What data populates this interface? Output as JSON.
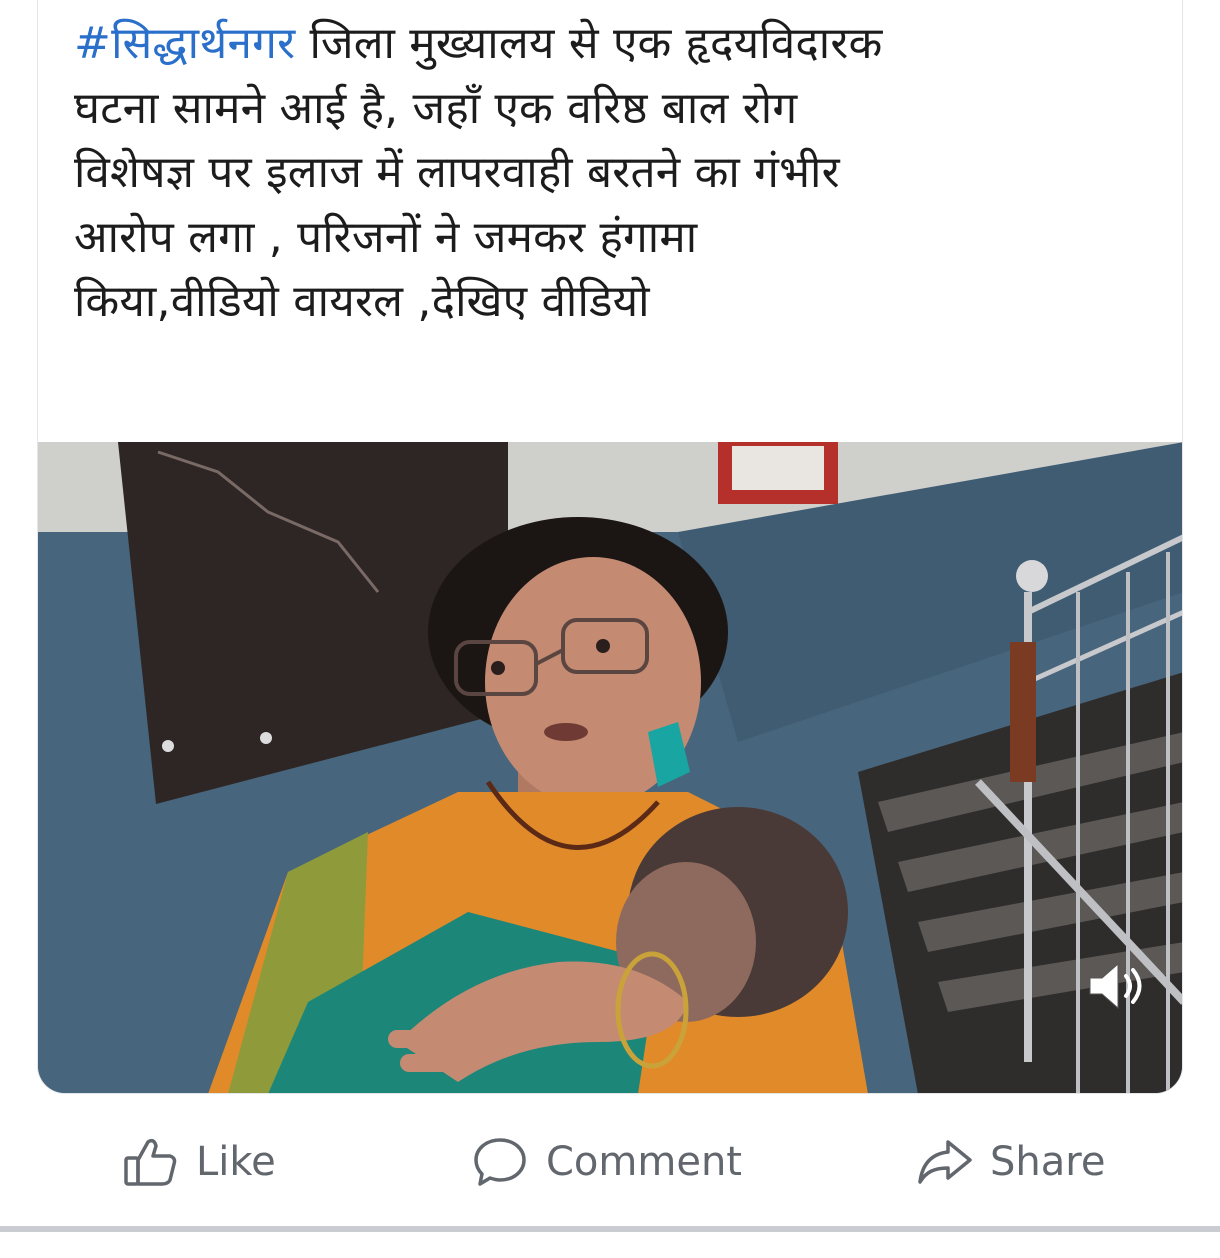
{
  "post": {
    "hashtag": "#सिद्धार्थनगर",
    "text_line1_rest": " जिला मुख्यालय से एक हृदयविदारक",
    "text_line2": "घटना सामने आई है, जहाँ एक वरिष्ठ बाल रोग",
    "text_line3": "विशेषज्ञ पर इलाज में लापरवाही बरतने का गंभीर",
    "text_line4": "आरोप लगा , परिजनों ने जमकर हंगामा",
    "text_line5": "किया,वीडियो वायरल ,देखिए वीडियो"
  },
  "media": {
    "type": "video",
    "sound_icon": "volume-icon"
  },
  "actions": {
    "like_label": "Like",
    "comment_label": "Comment",
    "share_label": "Share",
    "like_icon": "thumbs-up-icon",
    "comment_icon": "comment-bubble-icon",
    "share_icon": "share-arrow-icon"
  },
  "colors": {
    "hashtag": "#2a6fc9",
    "text": "#1c1c1c",
    "action_text": "#62666d",
    "divider": "#c9ccd1"
  }
}
